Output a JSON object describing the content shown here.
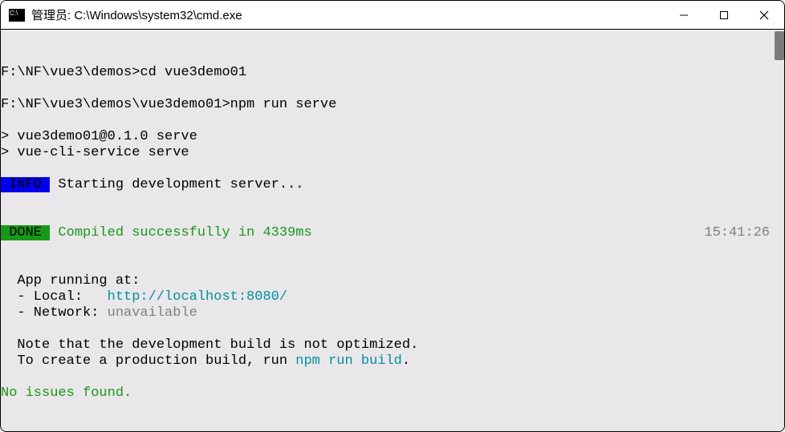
{
  "titlebar": {
    "title": "管理员:  C:\\Windows\\system32\\cmd.exe"
  },
  "terminal": {
    "prompt1_path": "F:\\NF\\vue3\\demos>",
    "prompt1_cmd": "cd vue3demo01",
    "prompt2_path": "F:\\NF\\vue3\\demos\\vue3demo01>",
    "prompt2_cmd": "npm run serve",
    "script_line1": "> vue3demo01@0.1.0 serve",
    "script_line2": "> vue-cli-service serve",
    "info_badge": " INFO ",
    "info_text": " Starting development server...",
    "done_badge": " DONE ",
    "done_text": " Compiled successfully in 4339ms",
    "done_time": "15:41:26",
    "app_running": "  App running at:",
    "local_label": "  - Local:   ",
    "local_url": "http://localhost:8080/",
    "network_label": "  - Network: ",
    "network_value": "unavailable",
    "note1": "  Note that the development build is not optimized.",
    "note2_prefix": "  To create a production build, run ",
    "note2_cmd": "npm run build",
    "note2_suffix": ".",
    "no_issues": "No issues found."
  }
}
